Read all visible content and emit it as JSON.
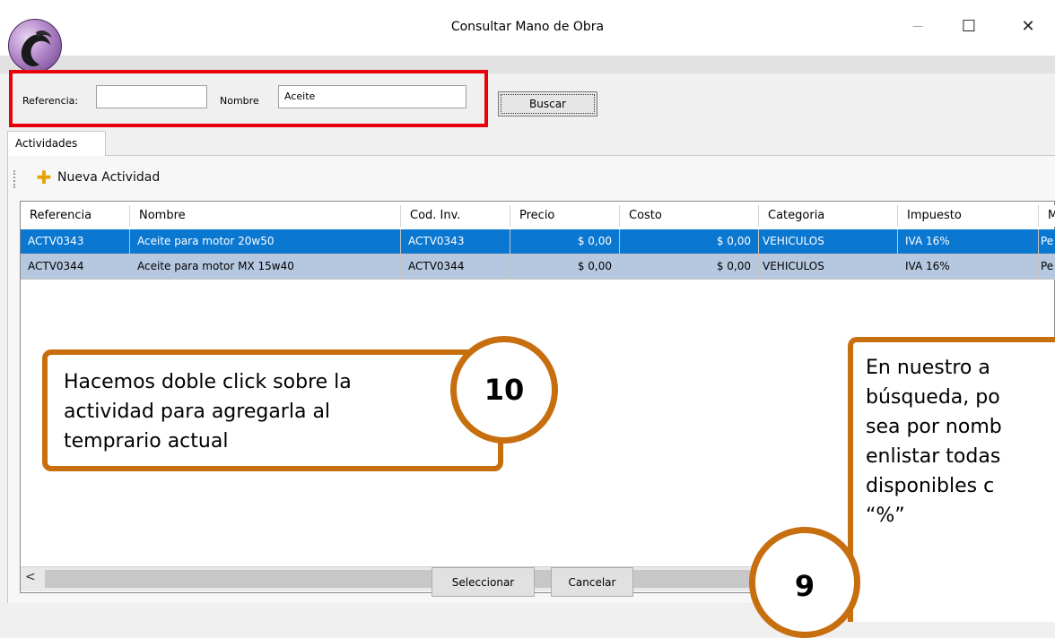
{
  "window": {
    "title": "Consultar Mano de Obra",
    "minimize_glyph": "—",
    "maximize_glyph": "☐",
    "close_glyph": "✕"
  },
  "search": {
    "referencia_label": "Referencia:",
    "referencia_value": "",
    "nombre_label": "Nombre",
    "nombre_value": "Aceite",
    "buscar_label": "Buscar"
  },
  "tabs": [
    {
      "label": "Actividades",
      "active": true
    }
  ],
  "toolbar": {
    "nueva_label": "Nueva Actividad",
    "nueva_icon": "plus-icon"
  },
  "table": {
    "columns": [
      "Referencia",
      "Nombre",
      "Cod. Inv.",
      "Precio",
      "Costo",
      "Categoria",
      "Impuesto",
      "M"
    ],
    "rows": [
      {
        "referencia": "ACTV0343",
        "nombre": "Aceite para motor  20w50",
        "cod_inv": "ACTV0343",
        "precio": "$ 0,00",
        "costo": "$ 0,00",
        "categoria": "VEHICULOS",
        "impuesto": "IVA 16%",
        "m": "Pe",
        "selected": true
      },
      {
        "referencia": "ACTV0344",
        "nombre": "Aceite para motor  MX 15w40",
        "cod_inv": "ACTV0344",
        "precio": "$ 0,00",
        "costo": "$ 0,00",
        "categoria": "VEHICULOS",
        "impuesto": "IVA 16%",
        "m": "Pe",
        "selected": false
      }
    ]
  },
  "footer": {
    "seleccionar_label": "Seleccionar",
    "cancelar_label": "Cancelar"
  },
  "callouts": {
    "step10": {
      "line1": "Hacemos doble click sobre la",
      "line2": "actividad para agregarla al",
      "line3": "temprario actual",
      "number": "10"
    },
    "step9": {
      "line1": "En nuestro a",
      "line2": "búsqueda, po",
      "line3": "sea por nomb",
      "line4": "enlistar todas",
      "line5": "disponibles c",
      "line6": "“%”",
      "number": "9"
    }
  },
  "colors": {
    "highlight_red": "#e8000b",
    "callout_orange": "#c76e0f",
    "row_selected": "#0a77d1",
    "row_alt": "#b6c8e0"
  }
}
